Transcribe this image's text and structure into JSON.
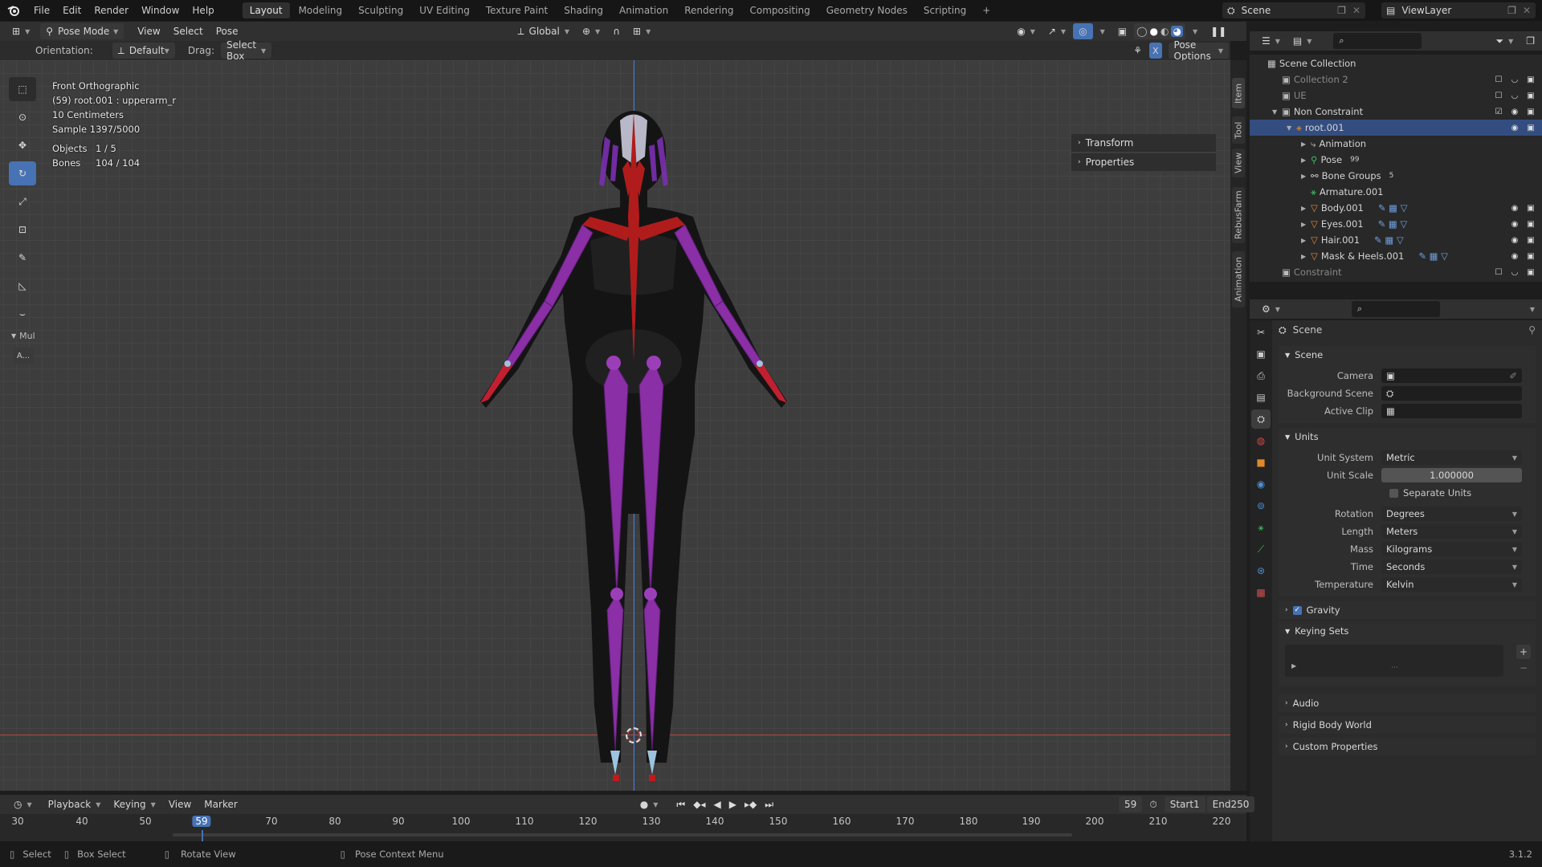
{
  "topbar": {
    "menus": [
      "File",
      "Edit",
      "Render",
      "Window",
      "Help"
    ],
    "workspaces": [
      "Layout",
      "Modeling",
      "Sculpting",
      "UV Editing",
      "Texture Paint",
      "Shading",
      "Animation",
      "Rendering",
      "Compositing",
      "Geometry Nodes",
      "Scripting"
    ],
    "active_workspace": "Layout",
    "add_tab": "+",
    "scene": "Scene",
    "view_layer": "ViewLayer"
  },
  "viewport_header": {
    "mode": "Pose Mode",
    "menus": [
      "View",
      "Select",
      "Pose"
    ],
    "transform_orientation": "Global"
  },
  "tool_settings": {
    "orientation_label": "Orientation:",
    "orientation_value": "Default",
    "drag_label": "Drag:",
    "drag_value": "Select Box",
    "pose_options": "Pose Options",
    "x_mirror": "X"
  },
  "viewport_info": {
    "view": "Front Orthographic",
    "object": "(59) root.001 : upperarm_r",
    "scale": "10 Centimeters",
    "sample": "Sample 1397/5000",
    "objects_label": "Objects",
    "objects_value": "1 / 5",
    "bones_label": "Bones",
    "bones_value": "104 / 104"
  },
  "toolbar_extra": {
    "mul": "Mul",
    "a": "A..."
  },
  "npanel": {
    "transform": "Transform",
    "properties": "Properties"
  },
  "side_tabs": [
    "Item",
    "Tool",
    "View",
    "RebusFarm",
    "Animation"
  ],
  "outliner": {
    "rows": [
      {
        "label": "Scene Collection",
        "indent": 0,
        "type": "scene",
        "dim": false
      },
      {
        "label": "Collection 2",
        "indent": 1,
        "type": "collection",
        "dim": true
      },
      {
        "label": "UE",
        "indent": 1,
        "type": "collection",
        "dim": true
      },
      {
        "label": "Non Constraint",
        "indent": 1,
        "type": "collection",
        "dim": false
      },
      {
        "label": "root.001",
        "indent": 2,
        "type": "armature",
        "dim": false,
        "selected": true
      },
      {
        "label": "Animation",
        "indent": 3,
        "type": "anim",
        "dim": false
      },
      {
        "label": "Pose",
        "indent": 3,
        "type": "pose",
        "dim": false,
        "badge": "99"
      },
      {
        "label": "Bone Groups",
        "indent": 3,
        "type": "bonegroups",
        "dim": false,
        "badge": "5"
      },
      {
        "label": "Armature.001",
        "indent": 3,
        "type": "armdata",
        "dim": false
      },
      {
        "label": "Body.001",
        "indent": 3,
        "type": "mesh",
        "dim": false
      },
      {
        "label": "Eyes.001",
        "indent": 3,
        "type": "mesh",
        "dim": false
      },
      {
        "label": "Hair.001",
        "indent": 3,
        "type": "mesh",
        "dim": false
      },
      {
        "label": "Mask & Heels.001",
        "indent": 3,
        "type": "mesh",
        "dim": false
      },
      {
        "label": "Constraint",
        "indent": 1,
        "type": "collection",
        "dim": true
      }
    ]
  },
  "properties": {
    "context": "Scene",
    "scene_section": "Scene",
    "camera_label": "Camera",
    "background_label": "Background Scene",
    "clip_label": "Active Clip",
    "units_section": "Units",
    "unit_system_label": "Unit System",
    "unit_system": "Metric",
    "unit_scale_label": "Unit Scale",
    "unit_scale": "1.000000",
    "separate_units": "Separate Units",
    "rotation_label": "Rotation",
    "rotation": "Degrees",
    "length_label": "Length",
    "length": "Meters",
    "mass_label": "Mass",
    "mass": "Kilograms",
    "time_label": "Time",
    "time": "Seconds",
    "temperature_label": "Temperature",
    "temperature": "Kelvin",
    "gravity": "Gravity",
    "keying_sets": "Keying Sets",
    "audio": "Audio",
    "rigid_body": "Rigid Body World",
    "custom_props": "Custom Properties"
  },
  "timeline": {
    "menus": [
      "Playback",
      "Keying",
      "View",
      "Marker"
    ],
    "current_frame": "59",
    "start_label": "Start",
    "start": "1",
    "end_label": "End",
    "end": "250",
    "ticks": [
      "30",
      "40",
      "50",
      "59",
      "70",
      "80",
      "90",
      "100",
      "110",
      "120",
      "130",
      "140",
      "150",
      "160",
      "170",
      "180",
      "190",
      "200",
      "210",
      "220"
    ]
  },
  "statusbar": {
    "select": "Select",
    "box_select": "Box Select",
    "rotate_view": "Rotate View",
    "context_menu": "Pose Context Menu",
    "version": "3.1.2"
  }
}
